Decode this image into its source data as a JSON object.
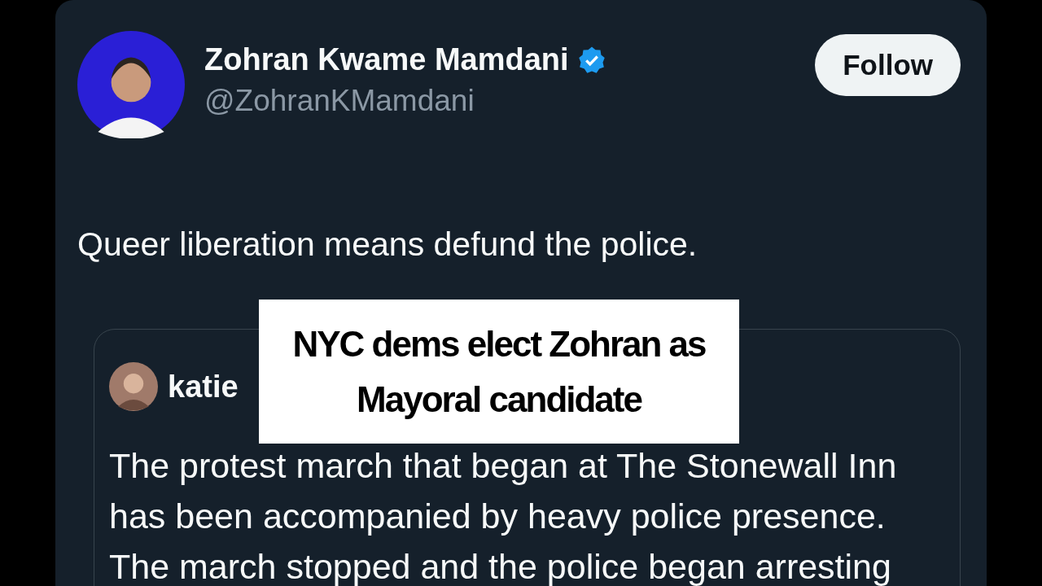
{
  "tweet": {
    "author": {
      "name": "Zohran Kwame Mamdani",
      "handle": "@ZohranKMamdani",
      "verified": true
    },
    "follow_button": "Follow",
    "text": "Queer liberation means defund the police.",
    "quoted_tweet": {
      "author": {
        "name": "katie"
      },
      "text": "The protest march that began at The Stonewall Inn has been accompanied by heavy police presence. The march stopped and the police began arresting"
    }
  },
  "caption": {
    "lines": [
      "NYC dems elect Zohran as",
      "Mayoral candidate"
    ]
  }
}
